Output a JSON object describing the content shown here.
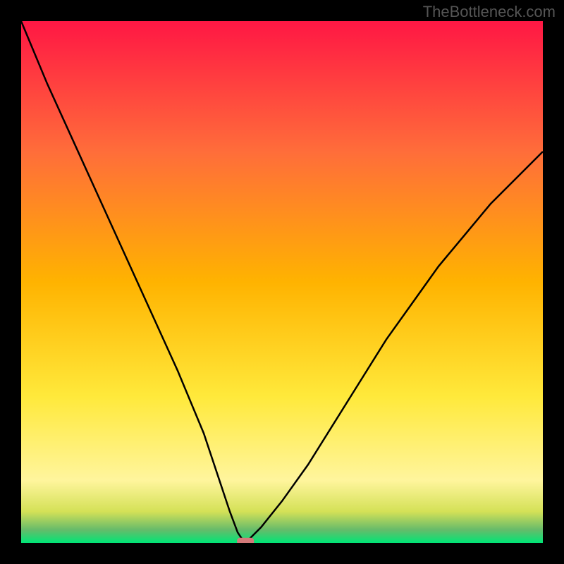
{
  "watermark": "TheBottleneck.com",
  "chart_data": {
    "type": "line",
    "title": "",
    "xlabel": "",
    "ylabel": "",
    "xlim": [
      0,
      100
    ],
    "ylim": [
      0,
      100
    ],
    "grid": false,
    "legend": false,
    "background_gradient": {
      "stops": [
        {
          "offset": 0,
          "color": "#ff1744"
        },
        {
          "offset": 0.25,
          "color": "#ff6d3a"
        },
        {
          "offset": 0.5,
          "color": "#ffb300"
        },
        {
          "offset": 0.72,
          "color": "#ffe93b"
        },
        {
          "offset": 0.88,
          "color": "#fff59d"
        },
        {
          "offset": 0.94,
          "color": "#d4e157"
        },
        {
          "offset": 0.975,
          "color": "#66bb6a"
        },
        {
          "offset": 1.0,
          "color": "#00e676"
        }
      ]
    },
    "series": [
      {
        "name": "curve",
        "color": "#000000",
        "x": [
          0,
          5,
          10,
          15,
          20,
          25,
          30,
          35,
          38,
          40,
          41.5,
          42.5,
          43,
          44,
          46,
          50,
          55,
          60,
          65,
          70,
          75,
          80,
          85,
          90,
          95,
          100
        ],
        "y": [
          100,
          88,
          77,
          66,
          55,
          44,
          33,
          21,
          12,
          6,
          2,
          0.5,
          0,
          1,
          3,
          8,
          15,
          23,
          31,
          39,
          46,
          53,
          59,
          65,
          70,
          75
        ]
      }
    ],
    "marker": {
      "x": 43,
      "y": 0.3,
      "color": "#d47a7a",
      "shape": "rounded-rect"
    }
  }
}
